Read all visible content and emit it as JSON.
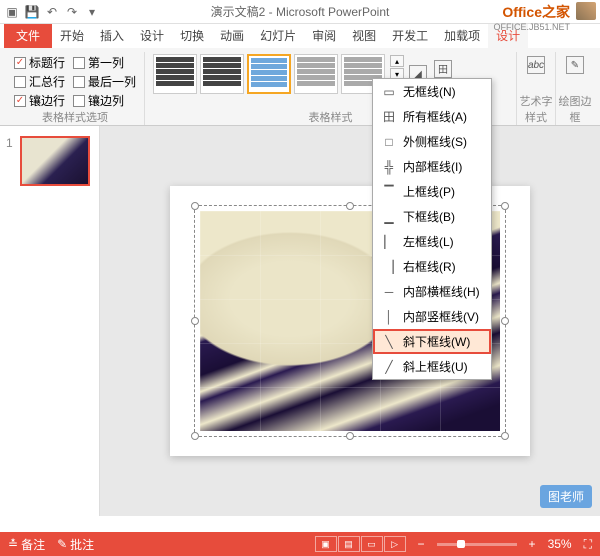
{
  "title": "演示文稿2 - Microsoft PowerPoint",
  "logo": {
    "text": "Office之家",
    "url": "OFFICE.JB51.NET"
  },
  "tabs": {
    "file": "文件",
    "start": "开始",
    "insert": "插入",
    "design": "设计",
    "transition": "切换",
    "animation": "动画",
    "slideshow": "幻灯片",
    "review": "审阅",
    "view": "视图",
    "developer": "开发工",
    "addin": "加载项",
    "tabledesign": "设计"
  },
  "options": {
    "header_row": "标题行",
    "first_col": "第一列",
    "total_row": "汇总行",
    "last_col": "最后一列",
    "banded_row": "镶边行",
    "banded_col": "镶边列",
    "group_label": "表格样式选项"
  },
  "styles": {
    "group_label": "表格样式"
  },
  "tools": {
    "wordart": "艺术字样式",
    "border": "绘图边框"
  },
  "borders": {
    "items": [
      {
        "icon": "▭",
        "label": "无框线(N)"
      },
      {
        "icon": "田",
        "label": "所有框线(A)"
      },
      {
        "icon": "□",
        "label": "外侧框线(S)"
      },
      {
        "icon": "╬",
        "label": "内部框线(I)"
      },
      {
        "icon": "▔",
        "label": "上框线(P)"
      },
      {
        "icon": "▁",
        "label": "下框线(B)"
      },
      {
        "icon": "▏",
        "label": "左框线(L)"
      },
      {
        "icon": "▕",
        "label": "右框线(R)"
      },
      {
        "icon": "─",
        "label": "内部横框线(H)"
      },
      {
        "icon": "│",
        "label": "内部竖框线(V)"
      },
      {
        "icon": "╲",
        "label": "斜下框线(W)"
      },
      {
        "icon": "╱",
        "label": "斜上框线(U)"
      }
    ]
  },
  "slide_num": "1",
  "watermark": "图老师",
  "status": {
    "notes": "备注",
    "comments": "批注",
    "zoom": "35%"
  }
}
